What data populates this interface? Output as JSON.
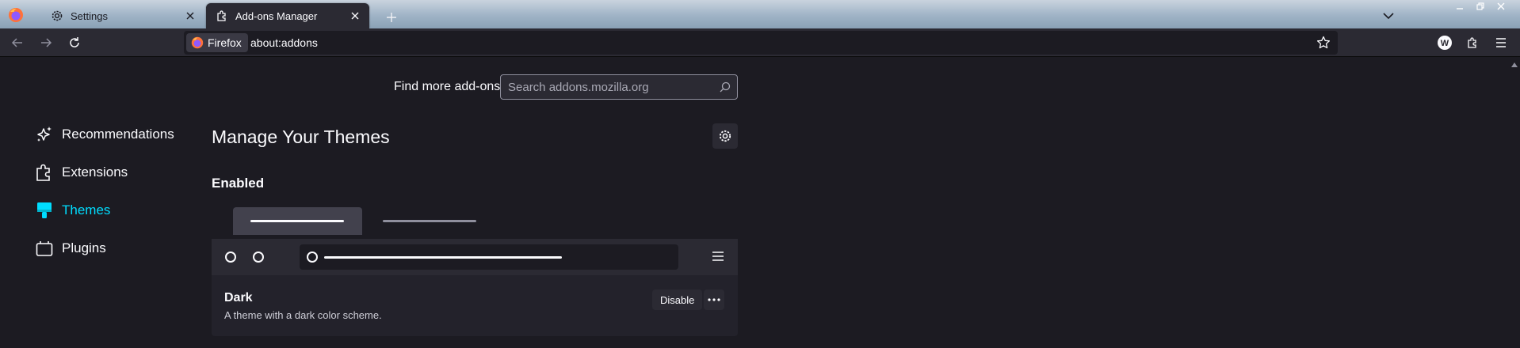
{
  "tabs": [
    {
      "label": "Settings",
      "icon": "gear-icon"
    },
    {
      "label": "Add-ons Manager",
      "icon": "puzzle-icon",
      "active": true
    }
  ],
  "urlbar": {
    "identity_label": "Firefox",
    "url": "about:addons"
  },
  "toolbar": {
    "account_avatar_letter": "W"
  },
  "find_addons": {
    "label": "Find more add-ons",
    "placeholder": "Search addons.mozilla.org"
  },
  "sidebar": {
    "items": [
      {
        "label": "Recommendations",
        "icon": "sparkle-icon"
      },
      {
        "label": "Extensions",
        "icon": "puzzle-icon"
      },
      {
        "label": "Themes",
        "icon": "brush-icon",
        "selected": true
      },
      {
        "label": "Plugins",
        "icon": "plugin-icon"
      }
    ]
  },
  "main": {
    "title": "Manage Your Themes",
    "section": "Enabled",
    "theme": {
      "name": "Dark",
      "description": "A theme with a dark color scheme.",
      "disable_label": "Disable"
    }
  },
  "colors": {
    "accent": "#00ddff",
    "background": "#1c1b22",
    "toolbar": "#2b2a33"
  }
}
